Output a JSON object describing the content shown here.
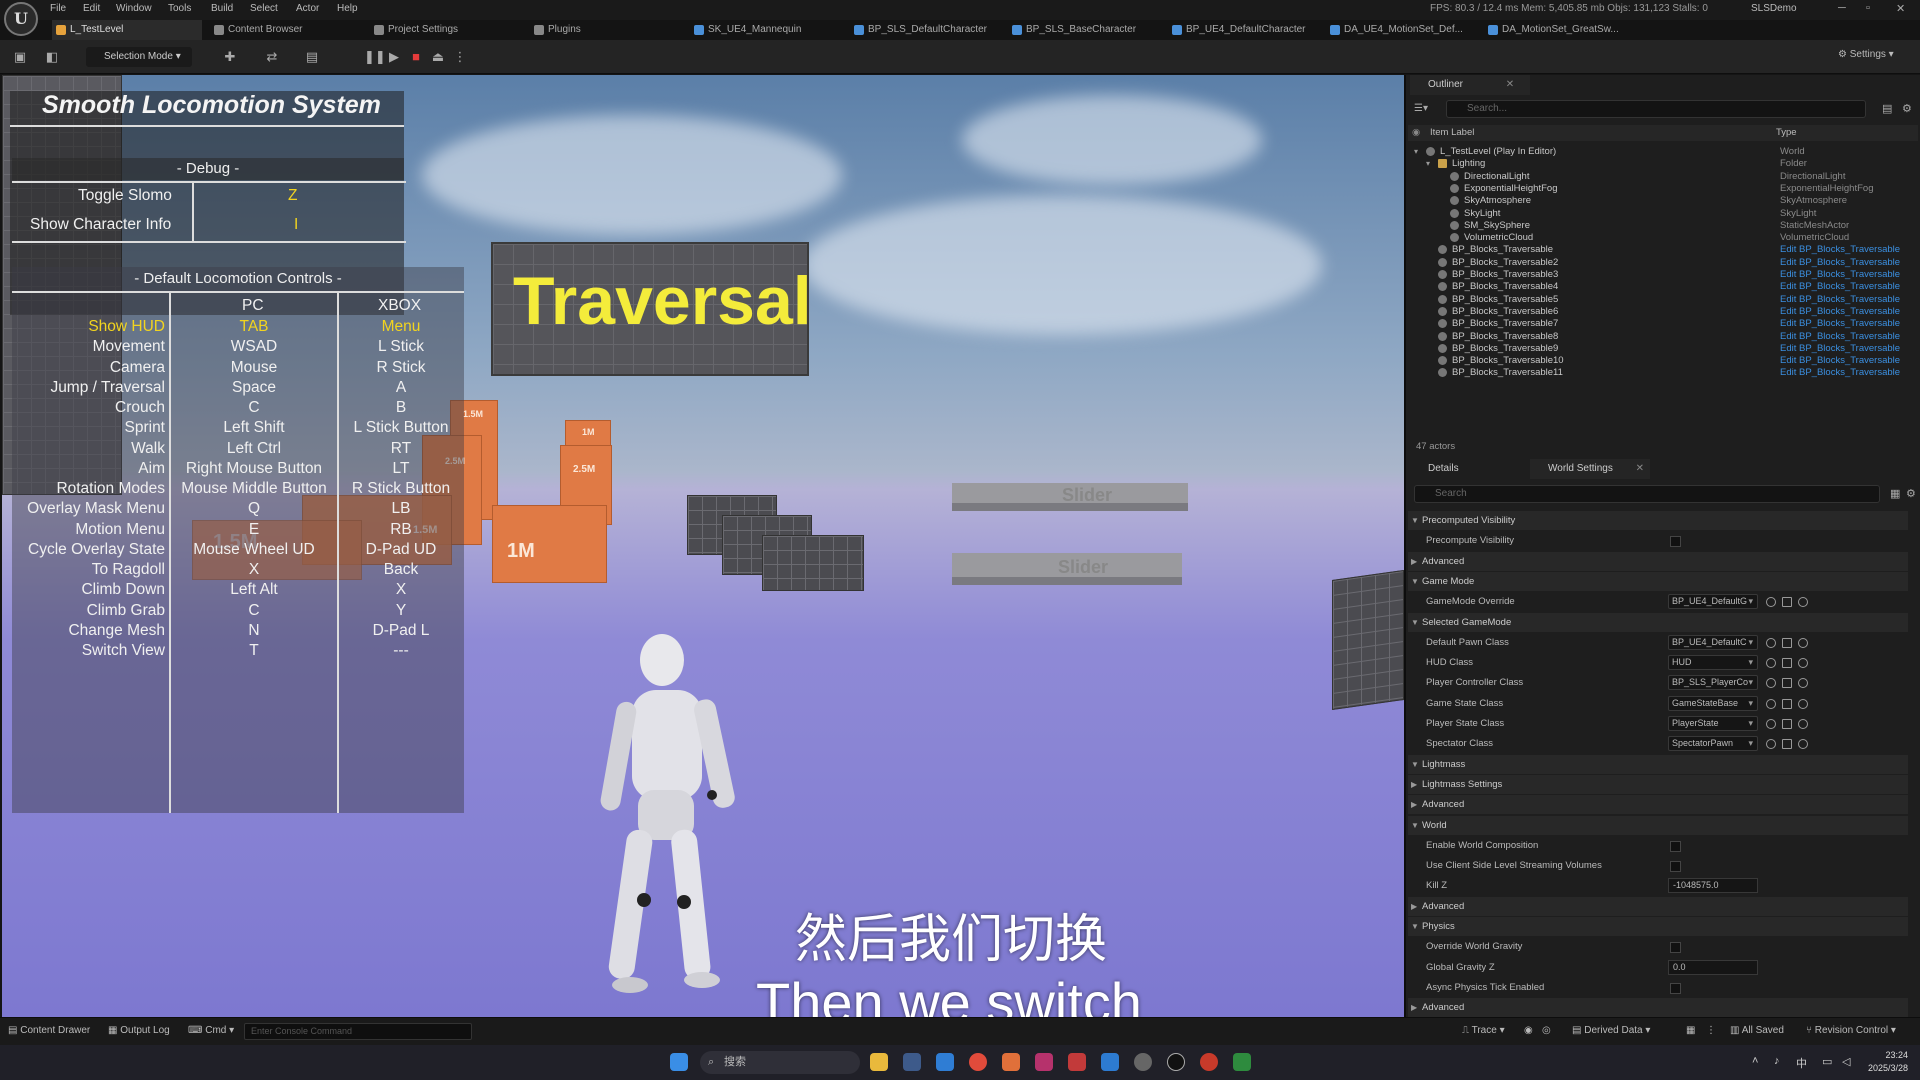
{
  "menu": {
    "items": [
      "File",
      "Edit",
      "Window",
      "Tools",
      "Build",
      "Select",
      "Actor",
      "Help"
    ],
    "status_line": "FPS: 80.3 / 12.4 ms  Mem: 5,405.85 mb  Objs: 131,123  Stalls: 0",
    "project_name": "SLSDemo"
  },
  "tabs": [
    {
      "label": "L_TestLevel",
      "color": "#e6a23c"
    },
    {
      "label": "Content Browser",
      "color": "#888888"
    },
    {
      "label": "Project Settings",
      "color": "#888888"
    },
    {
      "label": "Plugins",
      "color": "#888888"
    },
    {
      "label": "SK_UE4_Mannequin",
      "color": "#4a90d9"
    },
    {
      "label": "BP_SLS_DefaultCharacter",
      "color": "#4a90d9"
    },
    {
      "label": "BP_SLS_BaseCharacter",
      "color": "#4a90d9"
    },
    {
      "label": "BP_UE4_DefaultCharacter",
      "color": "#4a90d9"
    },
    {
      "label": "DA_UE4_MotionSet_Def...",
      "color": "#4a90d9"
    },
    {
      "label": "DA_MotionSet_GreatSw...",
      "color": "#4a90d9"
    }
  ],
  "toolbar": {
    "selection_mode": "Selection Mode",
    "settings": "Settings"
  },
  "hud": {
    "title": "Smooth Locomotion System",
    "debug_header": "- Debug -",
    "debug_rows": [
      {
        "label": "Toggle Slomo",
        "key": "Z"
      },
      {
        "label": "Show Character Info",
        "key": "I"
      }
    ],
    "controls_header": "- Default Locomotion Controls -",
    "col_pc": "PC",
    "col_xbox": "XBOX",
    "rows": [
      {
        "label": "Show HUD",
        "pc": "TAB",
        "xbox": "Menu",
        "highlight": true
      },
      {
        "label": "Movement",
        "pc": "WSAD",
        "xbox": "L Stick"
      },
      {
        "label": "Camera",
        "pc": "Mouse",
        "xbox": "R Stick"
      },
      {
        "label": "Jump / Traversal",
        "pc": "Space",
        "xbox": "A"
      },
      {
        "label": "Crouch",
        "pc": "C",
        "xbox": "B"
      },
      {
        "label": "Sprint",
        "pc": "Left Shift",
        "xbox": "L Stick Button"
      },
      {
        "label": "Walk",
        "pc": "Left Ctrl",
        "xbox": "RT"
      },
      {
        "label": "Aim",
        "pc": "Right Mouse Button",
        "xbox": "LT"
      },
      {
        "label": "Rotation Modes",
        "pc": "Mouse Middle Button",
        "xbox": "R Stick Button"
      },
      {
        "label": "Overlay Mask Menu",
        "pc": "Q",
        "xbox": "LB"
      },
      {
        "label": "Motion Menu",
        "pc": "E",
        "xbox": "RB"
      },
      {
        "label": "Cycle Overlay State",
        "pc": "Mouse Wheel UD",
        "xbox": "D-Pad UD"
      },
      {
        "label": "To Ragdoll",
        "pc": "X",
        "xbox": "Back"
      },
      {
        "label": "Climb Down",
        "pc": "Left Alt",
        "xbox": "X"
      },
      {
        "label": "Climb Grab",
        "pc": "C",
        "xbox": "Y"
      },
      {
        "label": "Change Mesh",
        "pc": "N",
        "xbox": "D-Pad L"
      },
      {
        "label": "Switch View",
        "pc": "T",
        "xbox": "---"
      }
    ]
  },
  "scene": {
    "traversal_sign": "Traversal",
    "slider_1": "Slider",
    "slider_2": "Slider",
    "block_labels": [
      "1.5M",
      "2.5M",
      "1M",
      "2.5M",
      "1.5M",
      "1M",
      "1.5M"
    ]
  },
  "subtitles": {
    "zh": "然后我们切换",
    "en": "Then we switch"
  },
  "outliner": {
    "tab_label": "Outliner",
    "search_placeholder": "Search...",
    "col_label": "Item Label",
    "col_type": "Type",
    "rows": [
      {
        "label": "L_TestLevel (Play In Editor)",
        "type": "World",
        "indent": 0,
        "link": false
      },
      {
        "label": "Lighting",
        "type": "Folder",
        "indent": 1,
        "link": false
      },
      {
        "label": "DirectionalLight",
        "type": "DirectionalLight",
        "indent": 2,
        "link": false
      },
      {
        "label": "ExponentialHeightFog",
        "type": "ExponentialHeightFog",
        "indent": 2,
        "link": false
      },
      {
        "label": "SkyAtmosphere",
        "type": "SkyAtmosphere",
        "indent": 2,
        "link": false
      },
      {
        "label": "SkyLight",
        "type": "SkyLight",
        "indent": 2,
        "link": false
      },
      {
        "label": "SM_SkySphere",
        "type": "StaticMeshActor",
        "indent": 2,
        "link": false
      },
      {
        "label": "VolumetricCloud",
        "type": "VolumetricCloud",
        "indent": 2,
        "link": false
      },
      {
        "label": "BP_Blocks_Traversable",
        "type": "Edit BP_Blocks_Traversable",
        "indent": 1,
        "link": true
      },
      {
        "label": "BP_Blocks_Traversable2",
        "type": "Edit BP_Blocks_Traversable",
        "indent": 1,
        "link": true
      },
      {
        "label": "BP_Blocks_Traversable3",
        "type": "Edit BP_Blocks_Traversable",
        "indent": 1,
        "link": true
      },
      {
        "label": "BP_Blocks_Traversable4",
        "type": "Edit BP_Blocks_Traversable",
        "indent": 1,
        "link": true
      },
      {
        "label": "BP_Blocks_Traversable5",
        "type": "Edit BP_Blocks_Traversable",
        "indent": 1,
        "link": true
      },
      {
        "label": "BP_Blocks_Traversable6",
        "type": "Edit BP_Blocks_Traversable",
        "indent": 1,
        "link": true
      },
      {
        "label": "BP_Blocks_Traversable7",
        "type": "Edit BP_Blocks_Traversable",
        "indent": 1,
        "link": true
      },
      {
        "label": "BP_Blocks_Traversable8",
        "type": "Edit BP_Blocks_Traversable",
        "indent": 1,
        "link": true
      },
      {
        "label": "BP_Blocks_Traversable9",
        "type": "Edit BP_Blocks_Traversable",
        "indent": 1,
        "link": true
      },
      {
        "label": "BP_Blocks_Traversable10",
        "type": "Edit BP_Blocks_Traversable",
        "indent": 1,
        "link": true
      },
      {
        "label": "BP_Blocks_Traversable11",
        "type": "Edit BP_Blocks_Traversable",
        "indent": 1,
        "link": true
      }
    ],
    "actor_count": "47 actors"
  },
  "details": {
    "tab_details": "Details",
    "tab_world_settings": "World Settings",
    "search_placeholder": "Search",
    "items": [
      {
        "kind": "section",
        "label": "Precomputed Visibility",
        "open": true
      },
      {
        "kind": "check",
        "label": "Precompute Visibility"
      },
      {
        "kind": "section",
        "label": "Advanced",
        "open": false
      },
      {
        "kind": "section",
        "label": "Game Mode",
        "open": true
      },
      {
        "kind": "combo",
        "label": "GameMode Override",
        "value": "BP_UE4_DefaultG"
      },
      {
        "kind": "section",
        "label": "Selected GameMode",
        "open": true
      },
      {
        "kind": "combo",
        "label": "Default Pawn Class",
        "value": "BP_UE4_DefaultC"
      },
      {
        "kind": "combo",
        "label": "HUD Class",
        "value": "HUD"
      },
      {
        "kind": "combo",
        "label": "Player Controller Class",
        "value": "BP_SLS_PlayerCo"
      },
      {
        "kind": "combo",
        "label": "Game State Class",
        "value": "GameStateBase"
      },
      {
        "kind": "combo",
        "label": "Player State Class",
        "value": "PlayerState"
      },
      {
        "kind": "combo",
        "label": "Spectator Class",
        "value": "SpectatorPawn"
      },
      {
        "kind": "section",
        "label": "Lightmass",
        "open": true
      },
      {
        "kind": "section",
        "label": "Lightmass Settings",
        "open": false
      },
      {
        "kind": "section",
        "label": "Advanced",
        "open": false
      },
      {
        "kind": "section",
        "label": "World",
        "open": true
      },
      {
        "kind": "check",
        "label": "Enable World Composition"
      },
      {
        "kind": "check",
        "label": "Use Client Side Level Streaming Volumes"
      },
      {
        "kind": "number",
        "label": "Kill Z",
        "value": "-1048575.0"
      },
      {
        "kind": "section",
        "label": "Advanced",
        "open": false
      },
      {
        "kind": "section",
        "label": "Physics",
        "open": true
      },
      {
        "kind": "check",
        "label": "Override World Gravity"
      },
      {
        "kind": "number",
        "label": "Global Gravity Z",
        "value": "0.0"
      },
      {
        "kind": "check",
        "label": "Async Physics Tick Enabled"
      },
      {
        "kind": "section",
        "label": "Advanced",
        "open": false
      }
    ]
  },
  "statusbar": {
    "content_drawer": "Content Drawer",
    "output_log": "Output Log",
    "cmd": "Cmd",
    "console_placeholder": "Enter Console Command",
    "trace": "Trace",
    "derived_data": "Derived Data",
    "all_saved": "All Saved",
    "revision_control": "Revision Control"
  },
  "taskbar": {
    "search": "搜索",
    "time": "23:24",
    "date": "2025/3/28"
  }
}
